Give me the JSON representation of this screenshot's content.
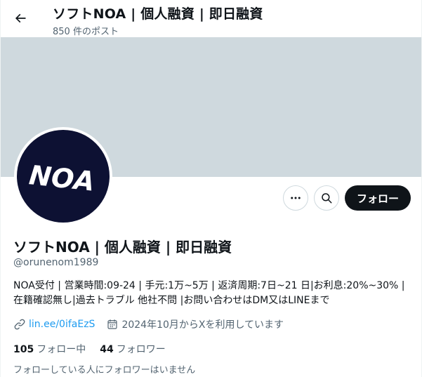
{
  "header": {
    "title": "ソフトNOA | 個人融資 | 即日融資",
    "post_count": "850 件のポスト"
  },
  "profile": {
    "avatar_text": "NOA",
    "display_name": "ソフトNOA | 個人融資 | 即日融資",
    "handle": "@orunenom1989",
    "bio_lines": [
      "NOA受付 | 営業時間:09-24 | 手元:1万~5万 | 返済周期:7日~21 日|お利息:20%~30% |",
      "在籍確認無し|過去トラブル 他社不問 |お問い合わせはDM又はLINEまで"
    ],
    "link_text": "lin.ee/0ifaEzS",
    "joined_text": "2024年10月からXを利用しています",
    "following_count": "105",
    "following_label": "フォロー中",
    "followers_count": "44",
    "followers_label": "フォロワー",
    "no_followers_note": "フォローしている人にフォロワーはいません"
  },
  "actions": {
    "follow_label": "フォロー"
  },
  "icons": {
    "back": "back-arrow-icon",
    "more": "more-dots-icon",
    "search": "search-icon",
    "link": "link-icon",
    "calendar": "calendar-icon"
  },
  "colors": {
    "banner": "#cfd9de",
    "avatar_bg": "#0d1133",
    "link": "#1d9bf0",
    "follow_button": "#0f1419",
    "secondary_text": "#536471"
  }
}
